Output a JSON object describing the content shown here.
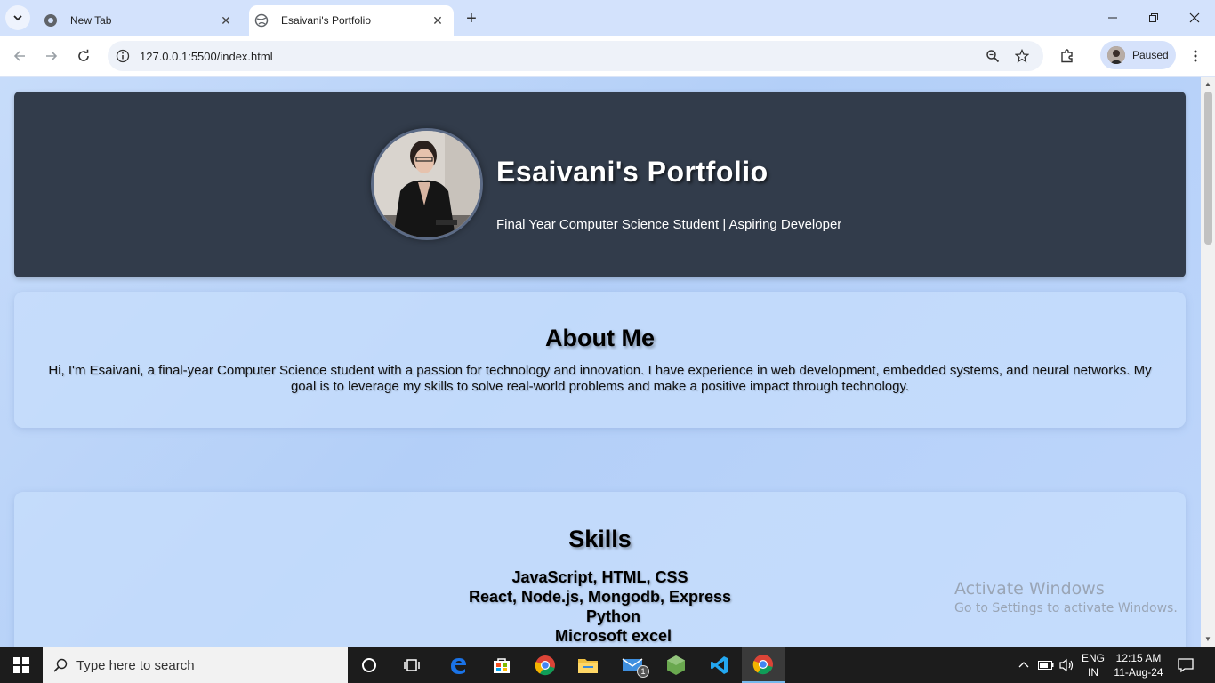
{
  "browser": {
    "tabs": [
      {
        "title": "New Tab",
        "active": false
      },
      {
        "title": "Esaivani's Portfolio",
        "active": true
      }
    ],
    "url": "127.0.0.1:5500/index.html",
    "profile_label": "Paused"
  },
  "page": {
    "hero": {
      "name": "Esaivani's Portfolio",
      "tagline": "Final Year Computer Science Student | Aspiring Developer"
    },
    "about": {
      "heading": "About Me",
      "text": "Hi, I'm Esaivani, a final-year Computer Science student with a passion for technology and innovation. I have experience in web development, embedded systems, and neural networks. My goal is to leverage my skills to solve real-world problems and make a positive impact through technology."
    },
    "skills": {
      "heading": "Skills",
      "items": [
        "JavaScript, HTML, CSS",
        "React, Node.js, Mongodb, Express",
        "Python",
        "Microsoft excel"
      ]
    }
  },
  "watermark": {
    "line1": "Activate Windows",
    "line2": "Go to Settings to activate Windows."
  },
  "taskbar": {
    "search_placeholder": "Type here to search",
    "mail_badge": "1",
    "lang_top": "ENG",
    "lang_bottom": "IN",
    "time": "12:15 AM",
    "date": "11-Aug-24"
  },
  "colors": {
    "tabstrip": "#d3e2fc",
    "hero_bg": "#323c4b",
    "page_gradient": "#b3cff8",
    "taskbar": "#1c1c1c"
  }
}
